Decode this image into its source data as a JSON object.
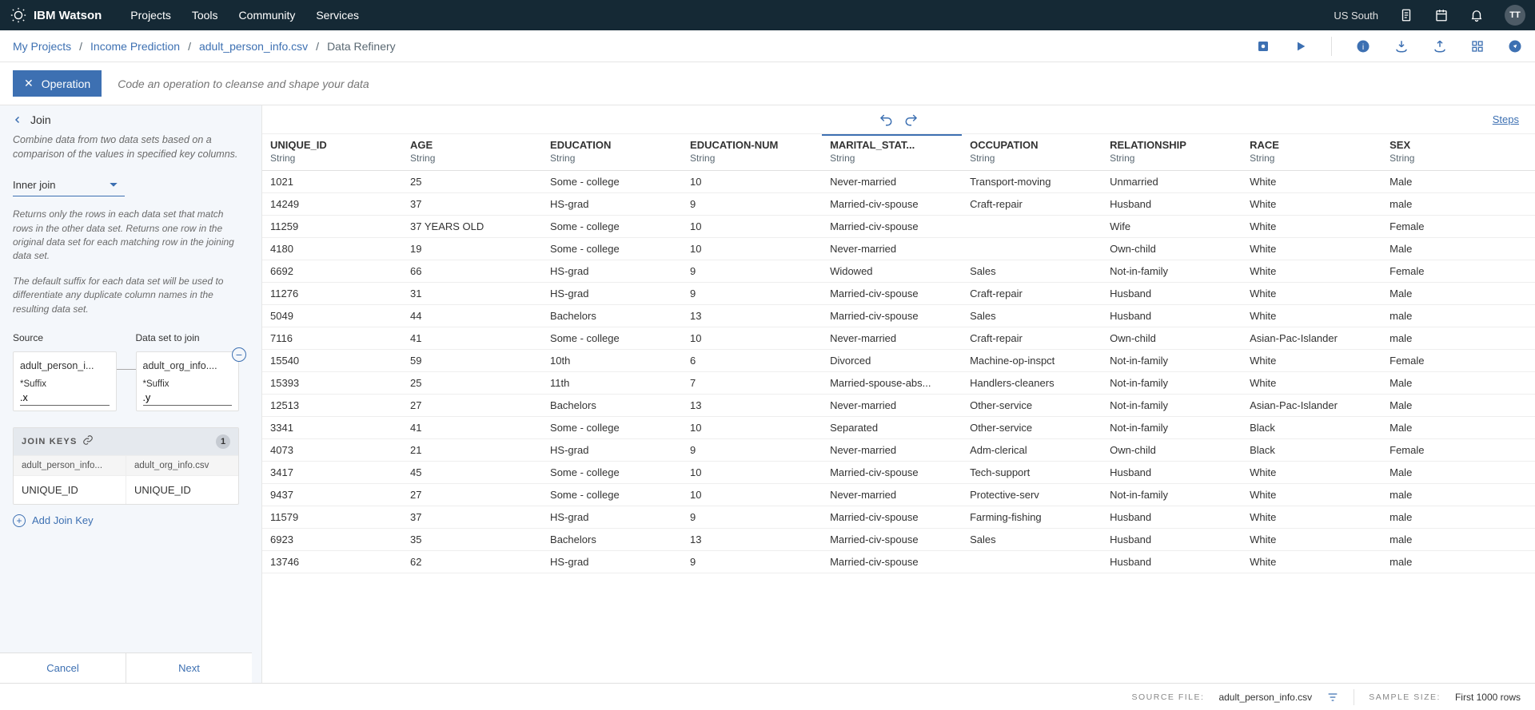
{
  "topbar": {
    "brand": "IBM Watson",
    "nav": [
      "Projects",
      "Tools",
      "Community",
      "Services"
    ],
    "region": "US South",
    "avatar": "TT"
  },
  "breadcrumbs": {
    "items": [
      "My Projects",
      "Income Prediction",
      "adult_person_info.csv",
      "Data Refinery"
    ]
  },
  "operation": {
    "button": "Operation",
    "placeholder": "Code an operation to cleanse and shape your data"
  },
  "sidebar": {
    "title": "Join",
    "desc": "Combine data from two data sets based on a comparison of the values in specified key columns.",
    "join_type": "Inner join",
    "explain1": "Returns only the rows in each data set that match rows in the other data set. Returns one row in the original data set for each matching row in the joining data set.",
    "explain2": "The default suffix for each data set will be used to differentiate any duplicate column names in the resulting data set.",
    "source_label": "Source",
    "join_label": "Data set to join",
    "source_ds": "adult_person_i...",
    "join_ds": "adult_org_info....",
    "suffix_label": "*Suffix",
    "source_suffix": ".x",
    "join_suffix": ".y",
    "jk_title": "JOIN KEYS",
    "jk_count": "1",
    "jk_header_left": "adult_person_info...",
    "jk_header_right": "adult_org_info.csv",
    "jk_val_left": "UNIQUE_ID",
    "jk_val_right": "UNIQUE_ID",
    "add_key": "Add Join Key",
    "cancel": "Cancel",
    "next": "Next"
  },
  "data_toolbar": {
    "steps": "Steps"
  },
  "table": {
    "columns": [
      {
        "name": "UNIQUE_ID",
        "type": "String"
      },
      {
        "name": "AGE",
        "type": "String"
      },
      {
        "name": "EDUCATION",
        "type": "String"
      },
      {
        "name": "EDUCATION-NUM",
        "type": "String"
      },
      {
        "name": "MARITAL_STAT...",
        "type": "String"
      },
      {
        "name": "OCCUPATION",
        "type": "String"
      },
      {
        "name": "RELATIONSHIP",
        "type": "String"
      },
      {
        "name": "RACE",
        "type": "String"
      },
      {
        "name": "SEX",
        "type": "String"
      }
    ],
    "rows": [
      [
        "1021",
        "25",
        "Some  -  college",
        "10",
        "Never-married",
        "Transport-moving",
        "Unmarried",
        "White",
        "Male"
      ],
      [
        "14249",
        "37",
        "            HS-grad",
        "9",
        "Married-civ-spouse",
        "Craft-repair",
        "Husband",
        "White",
        "male"
      ],
      [
        "11259",
        "37 YEARS OLD",
        "Some  -  college",
        "10",
        "Married-civ-spouse",
        "",
        "Wife",
        "White",
        "Female"
      ],
      [
        "4180",
        "19",
        "Some  -  college",
        "10",
        "Never-married",
        "",
        "Own-child",
        "White",
        "Male"
      ],
      [
        "6692",
        "66",
        "            HS-grad",
        "9",
        "Widowed",
        "Sales",
        "Not-in-family",
        "White",
        "Female"
      ],
      [
        "11276",
        "31",
        "            HS-grad",
        "9",
        "Married-civ-spouse",
        "Craft-repair",
        "Husband",
        "White",
        "Male"
      ],
      [
        "5049",
        "44",
        "Bachelors",
        "13",
        "Married-civ-spouse",
        "Sales",
        "Husband",
        "White",
        "male"
      ],
      [
        "7116",
        "41",
        "Some  -  college",
        "10",
        "Never-married",
        "Craft-repair",
        "Own-child",
        "Asian-Pac-Islander",
        "male"
      ],
      [
        "15540",
        "59",
        "10th",
        "6",
        "Divorced",
        "Machine-op-inspct",
        "Not-in-family",
        "White",
        "Female"
      ],
      [
        "15393",
        "25",
        "11th",
        "7",
        "Married-spouse-abs...",
        "Handlers-cleaners",
        "Not-in-family",
        "White",
        "Male"
      ],
      [
        "12513",
        "27",
        "Bachelors",
        "13",
        "Never-married",
        "Other-service",
        "Not-in-family",
        "Asian-Pac-Islander",
        "Male"
      ],
      [
        "3341",
        "41",
        "Some  -  college",
        "10",
        "Separated",
        "Other-service",
        "Not-in-family",
        "Black",
        "Male"
      ],
      [
        "4073",
        "21",
        "            HS-grad",
        "9",
        "Never-married",
        "Adm-clerical",
        "Own-child",
        "Black",
        "Female"
      ],
      [
        "3417",
        "45",
        "Some  -  college",
        "10",
        "Married-civ-spouse",
        "Tech-support",
        "Husband",
        "White",
        "Male"
      ],
      [
        "9437",
        "27",
        "Some  -  college",
        "10",
        "Never-married",
        "Protective-serv",
        "Not-in-family",
        "White",
        "male"
      ],
      [
        "11579",
        "37",
        "            HS-grad",
        "9",
        "Married-civ-spouse",
        "Farming-fishing",
        "Husband",
        "White",
        "male"
      ],
      [
        "6923",
        "35",
        "Bachelors",
        "13",
        "Married-civ-spouse",
        "Sales",
        "Husband",
        "White",
        "male"
      ],
      [
        "13746",
        "62",
        "            HS-grad",
        "9",
        "Married-civ-spouse",
        "",
        "Husband",
        "White",
        "male"
      ]
    ]
  },
  "status": {
    "source_label": "SOURCE FILE:",
    "source_val": "adult_person_info.csv",
    "sample_label": "SAMPLE SIZE:",
    "sample_val": "First 1000 rows"
  }
}
